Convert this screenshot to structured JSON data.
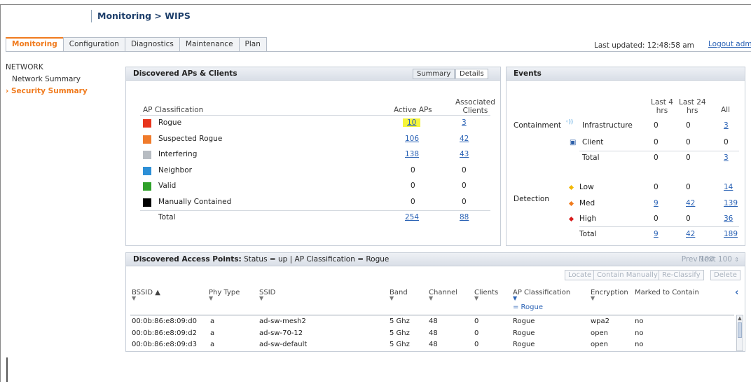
{
  "title": "Monitoring > WIPS",
  "tabs": [
    "Monitoring",
    "Configuration",
    "Diagnostics",
    "Maintenance",
    "Plan"
  ],
  "last_updated": "Last updated: 12:48:58 am",
  "logout": "Logout adm",
  "sidebar": {
    "heading": "NETWORK",
    "items": [
      "Network Summary",
      "Security Summary"
    ]
  },
  "discovered": {
    "title": "Discovered APs & Clients",
    "seg": [
      "Summary",
      "Details"
    ],
    "col_class": "AP Classification",
    "col_active": "Active APs",
    "col_assoc1": "Associated",
    "col_assoc2": "Clients",
    "colors": {
      "Rogue": "#e8341c",
      "Suspected Rogue": "#f07b2b",
      "Interfering": "#b7bcc2",
      "Neighbor": "#2d8fd6",
      "Valid": "#2fa12a",
      "Manually Contained": "#000000"
    },
    "rows": [
      {
        "label": "Rogue",
        "active": "10",
        "assoc": "3"
      },
      {
        "label": "Suspected Rogue",
        "active": "106",
        "assoc": "42"
      },
      {
        "label": "Interfering",
        "active": "138",
        "assoc": "43"
      },
      {
        "label": "Neighbor",
        "active": "0",
        "assoc": "0"
      },
      {
        "label": "Valid",
        "active": "0",
        "assoc": "0"
      },
      {
        "label": "Manually Contained",
        "active": "0",
        "assoc": "0"
      }
    ],
    "total": {
      "label": "Total",
      "active": "254",
      "assoc": "88"
    }
  },
  "events": {
    "title": "Events",
    "h_last4a": "Last 4",
    "h_last4b": "hrs",
    "h_last24a": "Last 24",
    "h_last24b": "hrs",
    "h_all": "All",
    "containment": "Containment",
    "detection": "Detection",
    "c_rows": [
      {
        "label": "Infrastructure",
        "l4": "0",
        "l24": "0",
        "all": "3"
      },
      {
        "label": "Client",
        "l4": "0",
        "l24": "0",
        "all": "0"
      },
      {
        "label": "Total",
        "l4": "0",
        "l24": "0",
        "all": "3"
      }
    ],
    "d_rows": [
      {
        "label": "Low",
        "l4": "0",
        "l24": "0",
        "all": "14",
        "color": "#f2b705"
      },
      {
        "label": "Med",
        "l4": "9",
        "l24": "42",
        "all": "139",
        "color": "#f07b1e"
      },
      {
        "label": "High",
        "l4": "0",
        "l24": "0",
        "all": "36",
        "color": "#d81b1b"
      },
      {
        "label": "Total",
        "l4": "9",
        "l24": "42",
        "all": "189"
      }
    ]
  },
  "aps": {
    "title_bold": "Discovered Access Points:",
    "title_rest": " Status = up | AP Classification = Rogue",
    "prev": "Prev 100",
    "next": "Next 100",
    "buttons": [
      "Locate",
      "Contain Manually",
      "Re-Classify",
      "Delete"
    ],
    "cols": [
      "BSSID",
      "Phy Type",
      "SSID",
      "Band",
      "Channel",
      "Clients",
      "AP Classification",
      "Encryption",
      "Marked to Contain"
    ],
    "filter": "= Rogue",
    "rows": [
      {
        "bssid": "00:0b:86:e8:09:d0",
        "phy": "a",
        "ssid": "ad-sw-mesh2",
        "band": "5 Ghz",
        "ch": "48",
        "cl": "0",
        "cls": "Rogue",
        "enc": "wpa2",
        "mark": "no"
      },
      {
        "bssid": "00:0b:86:e8:09:d2",
        "phy": "a",
        "ssid": "ad-sw-70-12",
        "band": "5 Ghz",
        "ch": "48",
        "cl": "0",
        "cls": "Rogue",
        "enc": "open",
        "mark": "no"
      },
      {
        "bssid": "00:0b:86:e8:09:d3",
        "phy": "a",
        "ssid": "ad-sw-default",
        "band": "5 Ghz",
        "ch": "48",
        "cl": "0",
        "cls": "Rogue",
        "enc": "open",
        "mark": "no"
      }
    ]
  }
}
